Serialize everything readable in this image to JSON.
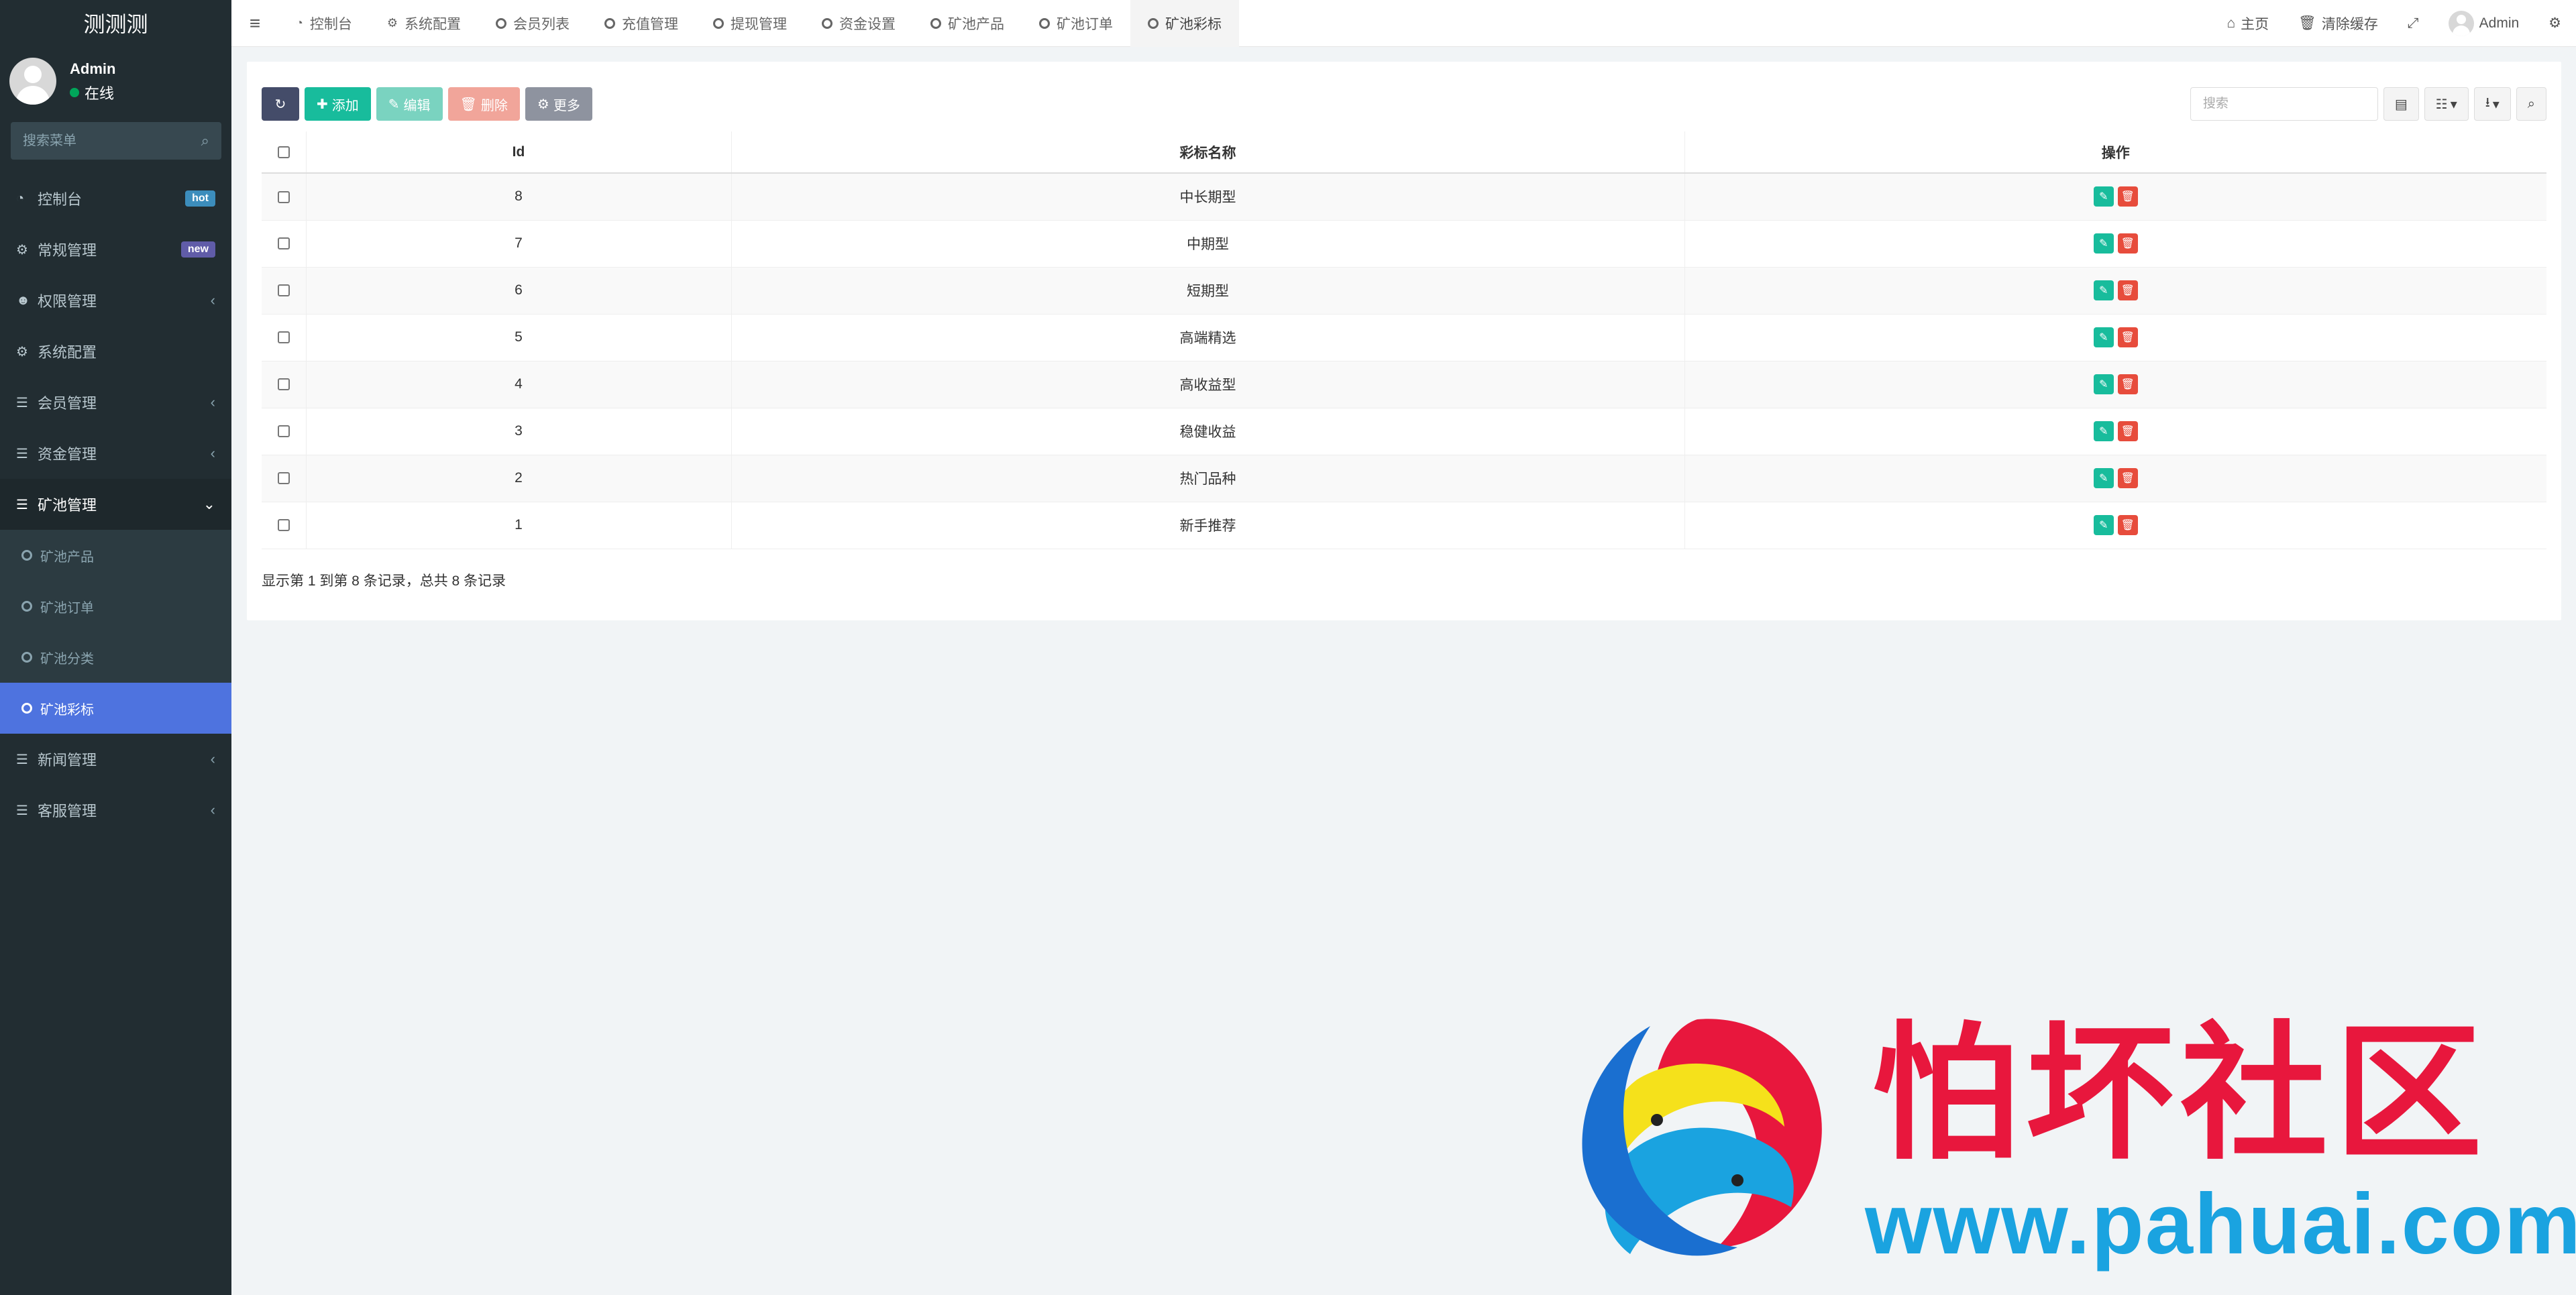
{
  "brand": "测测测",
  "user": {
    "name": "Admin",
    "status": "在线"
  },
  "sidebar_search": {
    "placeholder": "搜索菜单"
  },
  "menu": [
    {
      "label": "控制台",
      "icon": "dashboard-icon",
      "badge": "hot"
    },
    {
      "label": "常规管理",
      "icon": "cogs-icon",
      "badge": "new"
    },
    {
      "label": "权限管理",
      "icon": "users-icon",
      "arrow": "‹"
    },
    {
      "label": "系统配置",
      "icon": "gear-icon"
    },
    {
      "label": "会员管理",
      "icon": "list-icon",
      "arrow": "‹"
    },
    {
      "label": "资金管理",
      "icon": "list-icon",
      "arrow": "‹"
    },
    {
      "label": "矿池管理",
      "icon": "list-icon",
      "arrow": "⌄"
    }
  ],
  "submenu": [
    {
      "label": "矿池产品"
    },
    {
      "label": "矿池订单"
    },
    {
      "label": "矿池分类"
    },
    {
      "label": "矿池彩标",
      "active": true
    }
  ],
  "menu_after": [
    {
      "label": "新闻管理",
      "icon": "list-icon",
      "arrow": "‹"
    },
    {
      "label": "客服管理",
      "icon": "list-icon",
      "arrow": "‹"
    }
  ],
  "tabs": [
    {
      "label": "控制台",
      "icon": "dashboard-icon"
    },
    {
      "label": "系统配置",
      "icon": "gear-icon"
    },
    {
      "label": "会员列表",
      "icon": "circle-icon"
    },
    {
      "label": "充值管理",
      "icon": "circle-icon"
    },
    {
      "label": "提现管理",
      "icon": "circle-icon"
    },
    {
      "label": "资金设置",
      "icon": "circle-icon"
    },
    {
      "label": "矿池产品",
      "icon": "circle-icon"
    },
    {
      "label": "矿池订单",
      "icon": "circle-icon"
    },
    {
      "label": "矿池彩标",
      "icon": "circle-icon",
      "active": true
    }
  ],
  "topright": {
    "home": "主页",
    "clear_cache": "清除缓存",
    "admin": "Admin"
  },
  "toolbar": {
    "add": "添加",
    "edit": "编辑",
    "delete": "删除",
    "more": "更多"
  },
  "table_search": {
    "placeholder": "搜索"
  },
  "table": {
    "headers": [
      "Id",
      "彩标名称",
      "操作"
    ],
    "rows": [
      {
        "id": "8",
        "name": "中长期型"
      },
      {
        "id": "7",
        "name": "中期型"
      },
      {
        "id": "6",
        "name": "短期型"
      },
      {
        "id": "5",
        "name": "高端精选"
      },
      {
        "id": "4",
        "name": "高收益型"
      },
      {
        "id": "3",
        "name": "稳健收益"
      },
      {
        "id": "2",
        "name": "热门品种"
      },
      {
        "id": "1",
        "name": "新手推荐"
      }
    ]
  },
  "pager_info": "显示第 1 到第 8 条记录，总共 8 条记录",
  "watermark": {
    "title": "怕坏社区",
    "url": "www.pahuai.com"
  }
}
